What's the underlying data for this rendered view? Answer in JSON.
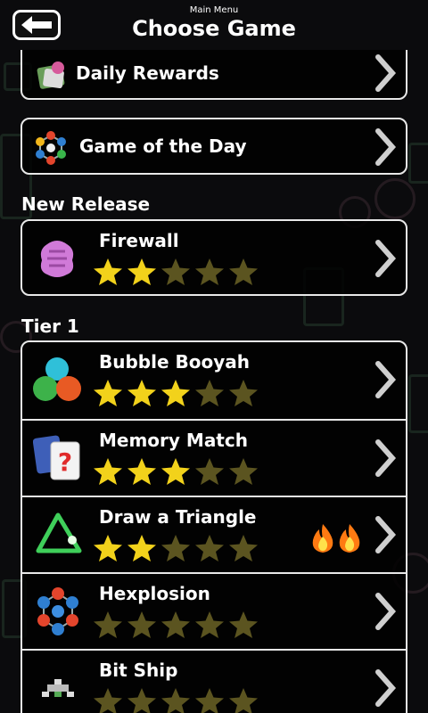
{
  "header": {
    "subtitle": "Main Menu",
    "title": "Choose Game"
  },
  "menu": {
    "daily_rewards": "Daily Rewards",
    "game_of_the_day": "Game of the Day"
  },
  "sections": {
    "new_release": "New Release",
    "tier1": "Tier 1"
  },
  "games": [
    {
      "name": "Firewall",
      "rating": 2
    },
    {
      "name": "Bubble Booyah",
      "rating": 3
    },
    {
      "name": "Memory Match",
      "rating": 3
    },
    {
      "name": "Draw a Triangle",
      "rating": 2,
      "badge": "fire-icon"
    },
    {
      "name": "Hexplosion",
      "rating": 0
    },
    {
      "name": "Bit Ship",
      "rating": 0
    }
  ],
  "colors": {
    "star_on": "#f2d21b",
    "star_off": "#5b5420",
    "border": "#e8e8e8"
  }
}
